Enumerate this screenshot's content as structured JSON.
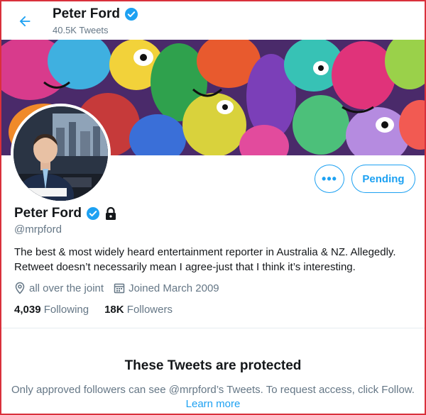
{
  "header": {
    "name": "Peter Ford",
    "tweet_count": "40.5K Tweets"
  },
  "profile": {
    "name": "Peter Ford",
    "handle": "@mrpford",
    "bio": "The best & most widely heard entertainment reporter in Australia & NZ. Allegedly. Retweet doesn’t necessarily mean I agree-just that I think it’s interesting.",
    "location": "all over the joint",
    "joined": "Joined March 2009",
    "following_count": "4,039",
    "following_label": "Following",
    "followers_count": "18K",
    "followers_label": "Followers"
  },
  "actions": {
    "more_label": "•••",
    "pending_label": "Pending"
  },
  "protected": {
    "title": "These Tweets are protected",
    "message": "Only approved followers can see @mrpford’s Tweets. To request access, click Follow.",
    "learn_more": "Learn more"
  },
  "icons": {
    "back": "arrow-left-icon",
    "verified": "verified-badge-icon",
    "lock": "lock-icon",
    "location": "location-pin-icon",
    "calendar": "calendar-icon"
  },
  "colors": {
    "accent": "#1da1f2",
    "secondary_text": "#657786",
    "frame_border": "#d9303b"
  }
}
